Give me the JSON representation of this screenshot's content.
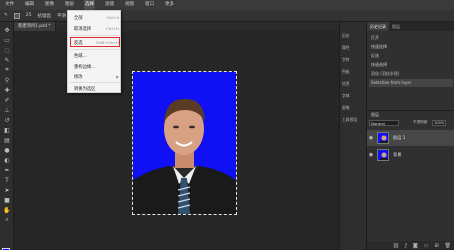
{
  "menubar": {
    "items": [
      "文件",
      "编辑",
      "图像",
      "图层",
      "选择",
      "滤镜",
      "视图",
      "窗口",
      "更多"
    ],
    "active_index": 4
  },
  "options": {
    "size_value": "25",
    "flags": [
      "抗锯齿",
      "平滑"
    ]
  },
  "document_tab": "新建项目1.psd *",
  "dropdown": {
    "items": [
      {
        "label": "全部",
        "shortcut": "Ctrl+A"
      },
      {
        "label": "取消选择",
        "shortcut": "Ctrl+D"
      },
      {
        "label": "反选",
        "shortcut": "Shift+Ctrl+I",
        "highlighted": true
      },
      {
        "label": "色域...",
        "shortcut": ""
      },
      {
        "label": "重构边缘...",
        "shortcut": ""
      },
      {
        "label": "修改",
        "shortcut": "▶"
      },
      {
        "label": "转换为选区",
        "shortcut": ""
      }
    ]
  },
  "history_panel": {
    "items": [
      "历史",
      "属性",
      "字符",
      "色板",
      "信息",
      "字体",
      "画笔",
      "工具预设"
    ]
  },
  "right_panel": {
    "tabs": [
      "历史记录",
      "图层"
    ],
    "history_rows": [
      "打开",
      "快速选择",
      "反选",
      "快速选择",
      "羽化 (羽化半径)",
      "Selection from layer"
    ],
    "layers_header": "图层",
    "blend_mode": "Normal",
    "opacity_label": "不透明度",
    "opacity_value": "100%",
    "layers": [
      {
        "name": "图层 1",
        "selected": true
      },
      {
        "name": "背景",
        "selected": false
      }
    ]
  },
  "colors": {
    "foreground": "#0000ff",
    "background": "#111111",
    "photo_bg": "#1010f4",
    "highlight": "#e0292d"
  }
}
